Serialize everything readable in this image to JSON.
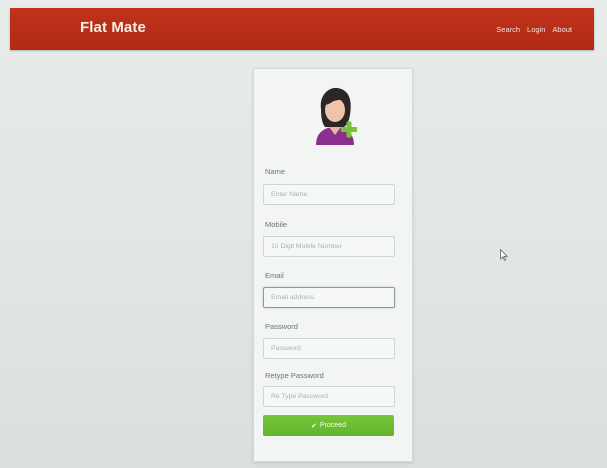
{
  "app": {
    "brand": "Flat Mate"
  },
  "nav": {
    "items": [
      {
        "label": "Search"
      },
      {
        "label": "Login"
      },
      {
        "label": "About"
      }
    ]
  },
  "form": {
    "avatar_icon": "add-user-icon",
    "fields": [
      {
        "label": "Name",
        "placeholder": "Enter Name",
        "value": ""
      },
      {
        "label": "Mobile",
        "placeholder": "10 Digit Mobile Number",
        "value": ""
      },
      {
        "label": "Email",
        "placeholder": "Email address",
        "value": ""
      },
      {
        "label": "Password",
        "placeholder": "Password",
        "value": ""
      },
      {
        "label": "Retype Password",
        "placeholder": "Re Type Password",
        "value": ""
      }
    ],
    "submit_label": "Proceed",
    "submit_icon": "check-icon"
  },
  "colors": {
    "navbar": "#b92f18",
    "button": "#6cbd34",
    "background": "#e2e6e5"
  }
}
